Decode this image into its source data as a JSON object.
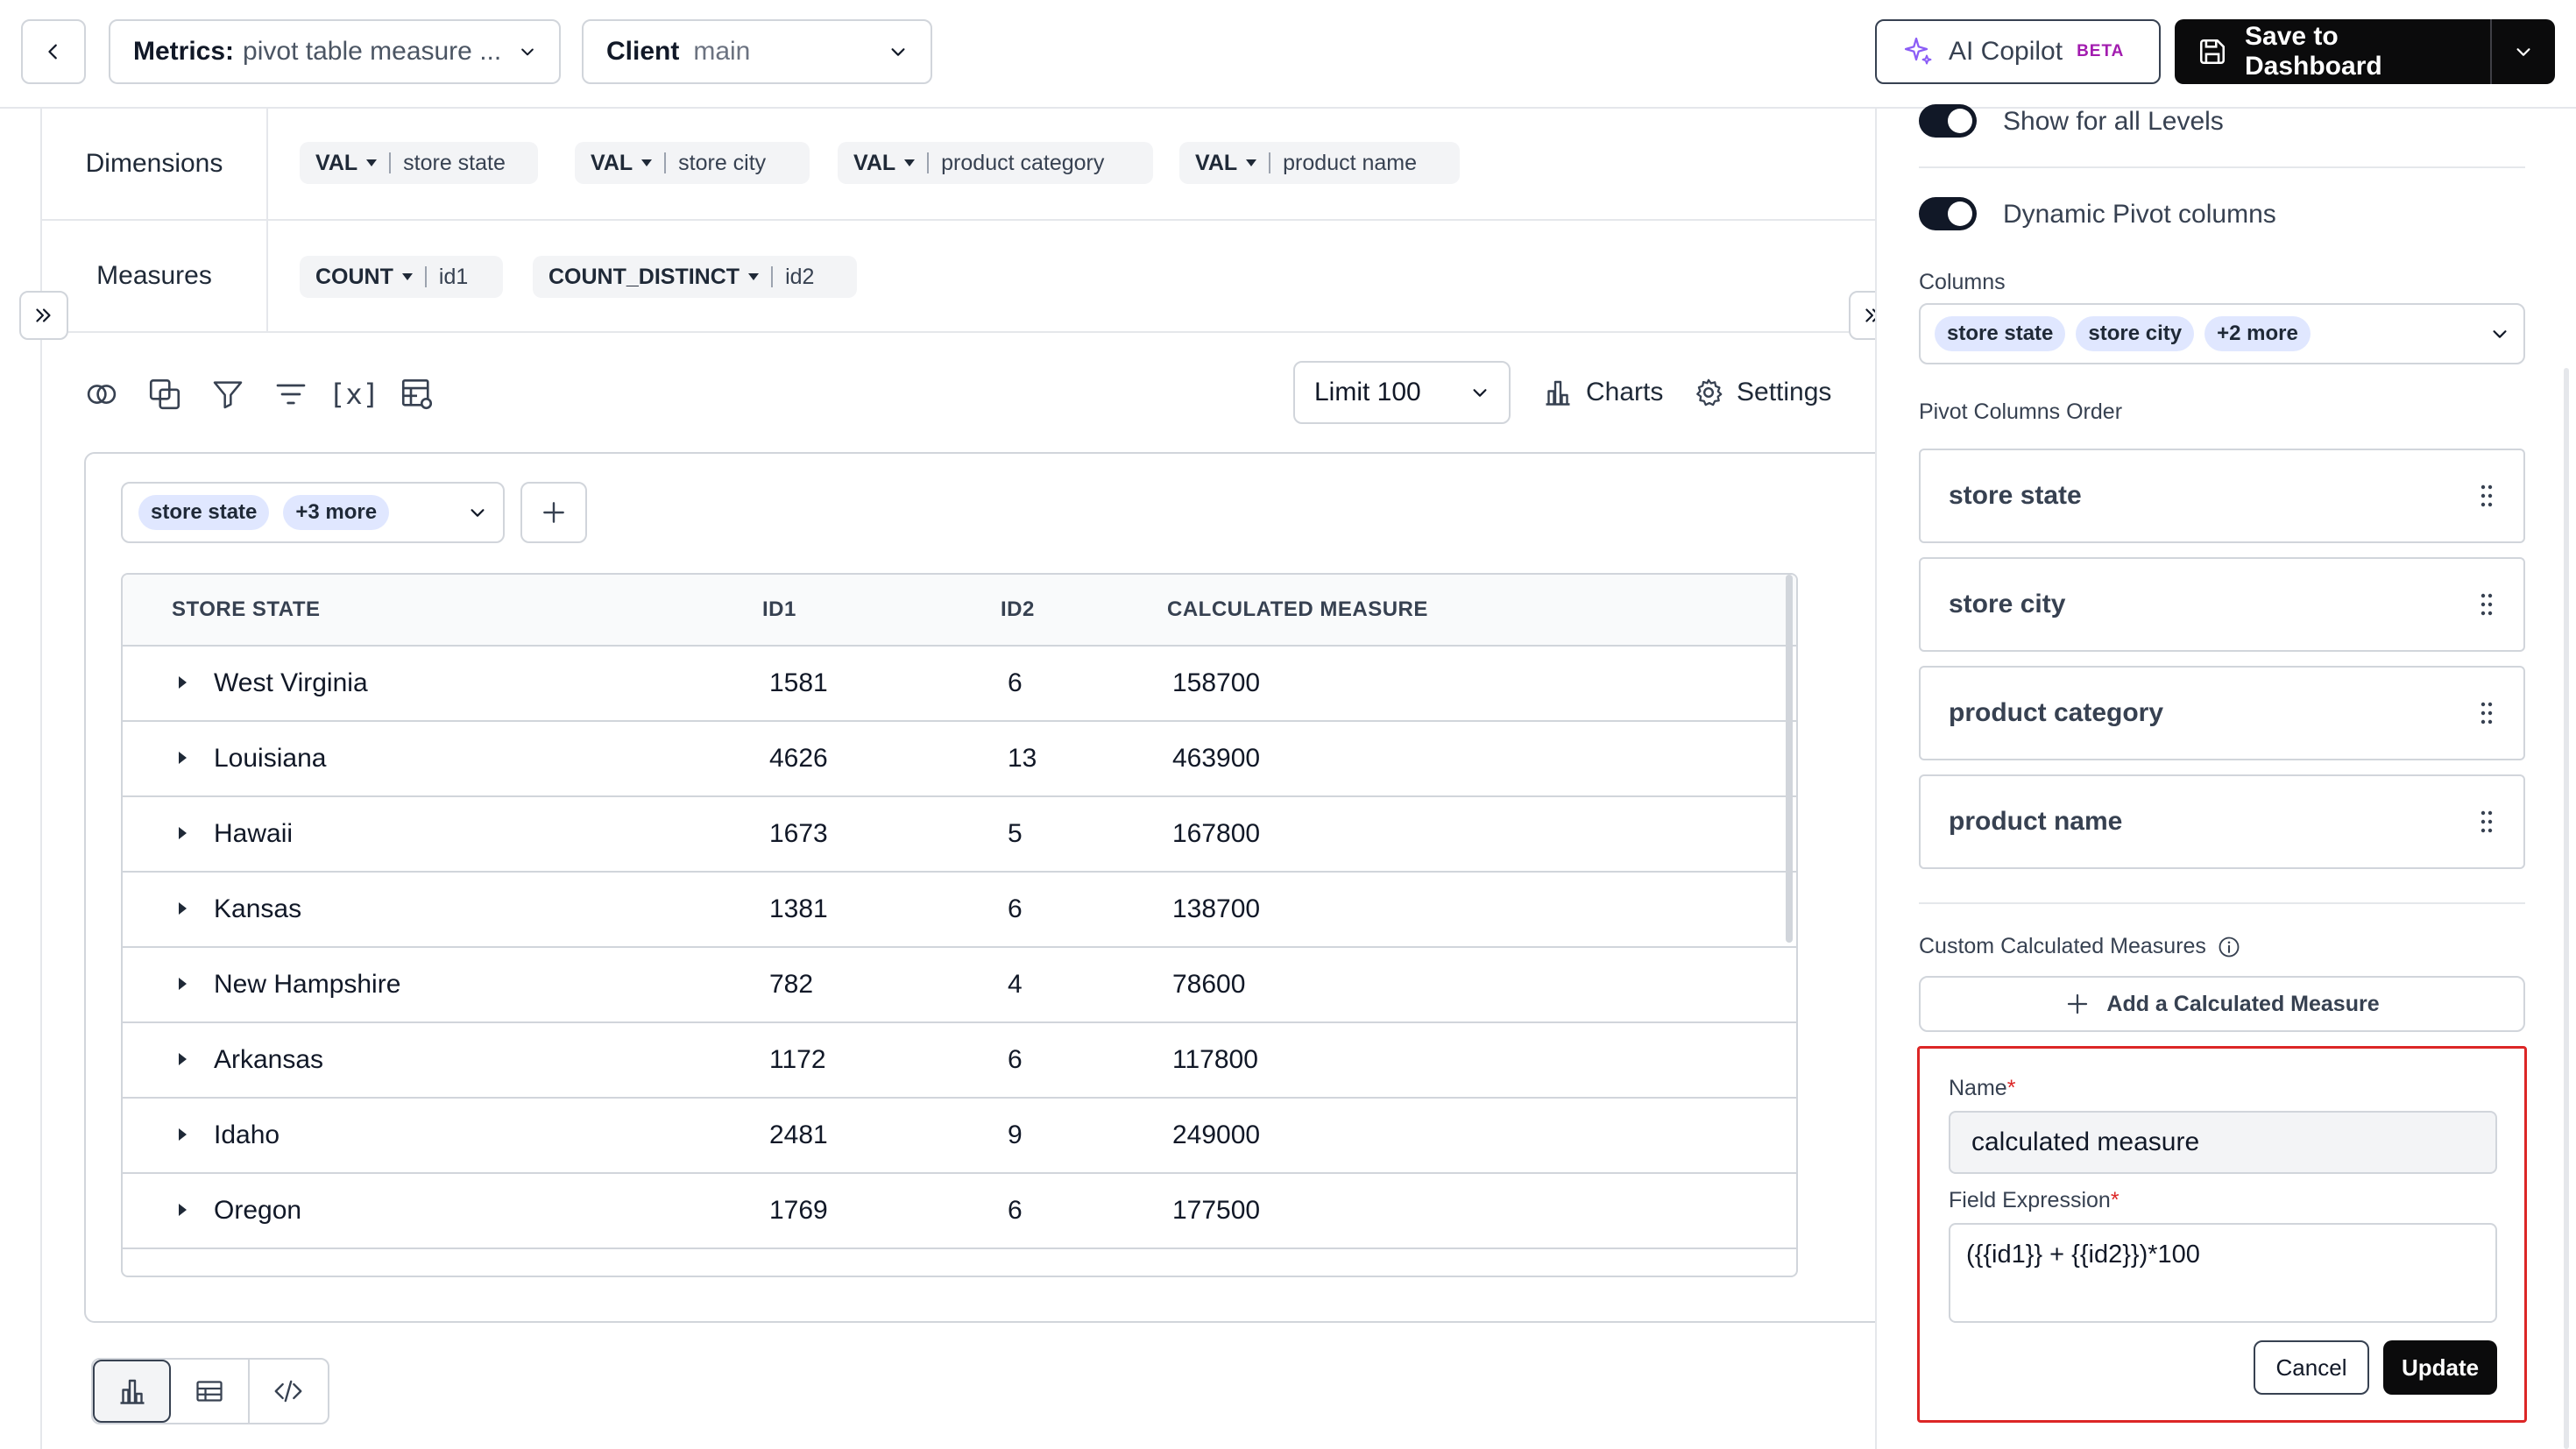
{
  "header": {
    "metric_key": "Metrics:",
    "metric_value": "pivot table measure ...",
    "client_key": "Client",
    "client_value": "main",
    "copilot_label": "AI Copilot",
    "copilot_badge": "BETA",
    "save_label": "Save to Dashboard"
  },
  "dimensions": {
    "label": "Dimensions",
    "chips": [
      {
        "agg": "VAL",
        "field": "store state"
      },
      {
        "agg": "VAL",
        "field": "store city"
      },
      {
        "agg": "VAL",
        "field": "product category"
      },
      {
        "agg": "VAL",
        "field": "product name"
      }
    ]
  },
  "measures": {
    "label": "Measures",
    "chips": [
      {
        "agg": "COUNT",
        "field": "id1"
      },
      {
        "agg": "COUNT_DISTINCT",
        "field": "id2"
      }
    ]
  },
  "toolbar": {
    "icons": [
      "join-icon",
      "copy-icon",
      "filter-icon",
      "sort-icon",
      "variable-icon",
      "table-settings-icon"
    ],
    "variable_text": "[x]",
    "limit_label": "Limit 100",
    "charts_label": "Charts",
    "settings_label": "Settings"
  },
  "grouping": {
    "pill": "store state",
    "more": "+3 more"
  },
  "table": {
    "columns": [
      "STORE STATE",
      "ID1",
      "ID2",
      "CALCULATED MEASURE"
    ],
    "rows": [
      [
        "West Virginia",
        "1581",
        "6",
        "158700"
      ],
      [
        "Louisiana",
        "4626",
        "13",
        "463900"
      ],
      [
        "Hawaii",
        "1673",
        "5",
        "167800"
      ],
      [
        "Kansas",
        "1381",
        "6",
        "138700"
      ],
      [
        "New Hampshire",
        "782",
        "4",
        "78600"
      ],
      [
        "Arkansas",
        "1172",
        "6",
        "117800"
      ],
      [
        "Idaho",
        "2481",
        "9",
        "249000"
      ],
      [
        "Oregon",
        "1769",
        "6",
        "177500"
      ]
    ]
  },
  "view_tabs": [
    "chart-view",
    "table-view",
    "code-view"
  ],
  "right_panel": {
    "show_all_levels": "Show for all Levels",
    "dynamic_pivot": "Dynamic Pivot columns",
    "columns_label": "Columns",
    "column_pills": [
      "store state",
      "store city"
    ],
    "column_more": "+2 more",
    "order_label": "Pivot Columns Order",
    "order_items": [
      "store state",
      "store city",
      "product category",
      "product name"
    ],
    "custom_label": "Custom Calculated Measures",
    "add_calc_label": "Add a Calculated Measure",
    "name_label": "Name",
    "name_value": "calculated measure",
    "expr_label": "Field Expression",
    "expr_value": "({{id1}} + {{id2}})*100",
    "required_mark": "*",
    "cancel_label": "Cancel",
    "update_label": "Update"
  },
  "colors": {
    "accent": "#0b0b0c",
    "pill_bg": "#e0e7ff",
    "highlight_border": "#dc2626",
    "beta": "#a21caf"
  }
}
